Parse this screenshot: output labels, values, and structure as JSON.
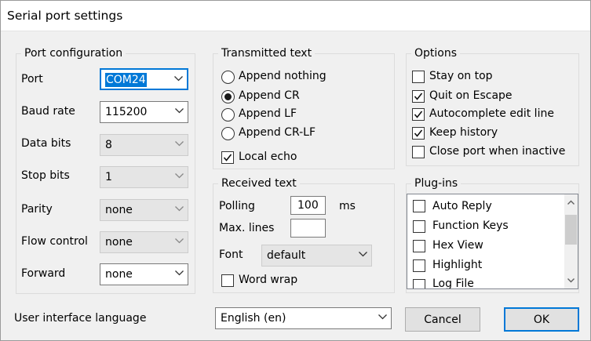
{
  "window": {
    "title": "Serial port settings"
  },
  "port_config": {
    "legend": "Port configuration",
    "rows": [
      {
        "label": "Port",
        "value": "COM24"
      },
      {
        "label": "Baud rate",
        "value": "115200"
      },
      {
        "label": "Data bits",
        "value": "8"
      },
      {
        "label": "Stop bits",
        "value": "1"
      },
      {
        "label": "Parity",
        "value": "none"
      },
      {
        "label": "Flow control",
        "value": "none"
      },
      {
        "label": "Forward",
        "value": "none"
      }
    ]
  },
  "transmitted": {
    "legend": "Transmitted text",
    "radios": [
      "Append nothing",
      "Append CR",
      "Append LF",
      "Append CR-LF"
    ],
    "selected": "Append CR",
    "local_echo": "Local echo"
  },
  "received": {
    "legend": "Received text",
    "polling_label": "Polling",
    "polling_value": "100",
    "polling_unit": "ms",
    "max_lines_label": "Max. lines",
    "max_lines_value": "",
    "font_label": "Font",
    "font_value": "default",
    "word_wrap": "Word wrap"
  },
  "options": {
    "legend": "Options",
    "items": [
      {
        "label": "Stay on top",
        "checked": false
      },
      {
        "label": "Quit on Escape",
        "checked": true
      },
      {
        "label": "Autocomplete edit line",
        "checked": true
      },
      {
        "label": "Keep history",
        "checked": true
      },
      {
        "label": "Close port when inactive",
        "checked": false
      }
    ]
  },
  "plugins": {
    "legend": "Plug-ins",
    "items": [
      "Auto Reply",
      "Function Keys",
      "Hex View",
      "Highlight",
      "Log File"
    ]
  },
  "footer": {
    "language_label": "User interface language",
    "language_value": "English (en)",
    "cancel": "Cancel",
    "ok": "OK"
  },
  "colors": {
    "accent": "#0078d7",
    "background": "#f0f0f0"
  }
}
